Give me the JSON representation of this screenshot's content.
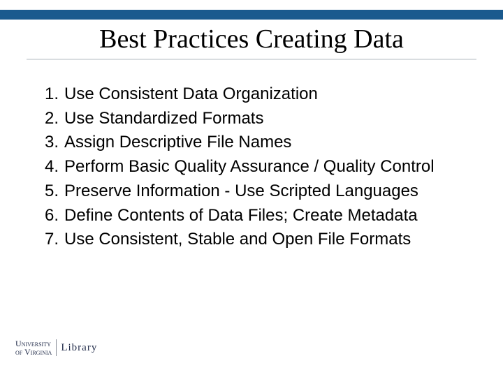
{
  "title": "Best Practices Creating Data",
  "items": [
    "Use Consistent Data Organization",
    "Use Standardized Formats",
    "Assign Descriptive File Names",
    "Perform Basic Quality Assurance / Quality Control",
    "Preserve Information - Use Scripted Languages",
    "Define Contents of Data Files; Create Metadata",
    "Use Consistent, Stable and Open File Formats"
  ],
  "footer": {
    "line1": "University",
    "line2": "of Virginia",
    "line3": "Library"
  }
}
